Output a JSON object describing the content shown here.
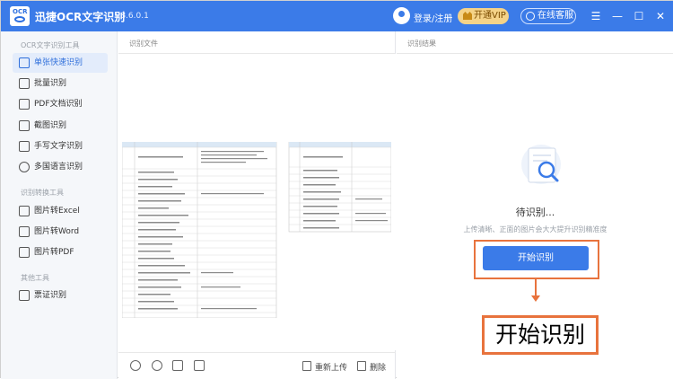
{
  "app": {
    "title": "迅捷OCR文字识别",
    "version": "v8.6.0.1",
    "logo_text": "OCR",
    "login_label": "登录/注册",
    "vip_label": "开通VIP",
    "service_label": "在线客服",
    "menu_icon": "☰",
    "minimize_icon": "—",
    "maximize_icon": "☐",
    "close_icon": "✕"
  },
  "sidebar": {
    "section1": "OCR文字识别工具",
    "section2": "识别转换工具",
    "section3": "其他工具",
    "items": [
      {
        "label": "单张快速识别",
        "icon": "image-icon",
        "active": true
      },
      {
        "label": "批量识别",
        "icon": "batch-icon",
        "active": false
      },
      {
        "label": "PDF文档识别",
        "icon": "pdf-icon",
        "active": false
      },
      {
        "label": "截图识别",
        "icon": "screenshot-icon",
        "active": false
      },
      {
        "label": "手写文字识别",
        "icon": "handwriting-icon",
        "active": false
      },
      {
        "label": "多国语言识别",
        "icon": "globe-icon",
        "active": false
      },
      {
        "label": "图片转Excel",
        "icon": "excel-icon",
        "active": false
      },
      {
        "label": "图片转Word",
        "icon": "word-icon",
        "active": false
      },
      {
        "label": "图片转PDF",
        "icon": "pdf-convert-icon",
        "active": false
      },
      {
        "label": "票证识别",
        "icon": "ticket-icon",
        "active": false
      }
    ]
  },
  "middle": {
    "title": "识别文件",
    "reupload_label": "重新上传",
    "delete_label": "删除"
  },
  "right": {
    "title": "识别结果",
    "waiting_text": "待识别...",
    "hint_text": "上传清晰、正面的图片会大大提升识别精准度",
    "start_button": "开始识别",
    "callout_text": "开始识别"
  },
  "colors": {
    "brand": "#3b7be8",
    "accent_orange": "#e8733d",
    "vip_gold": "#f5d388"
  }
}
